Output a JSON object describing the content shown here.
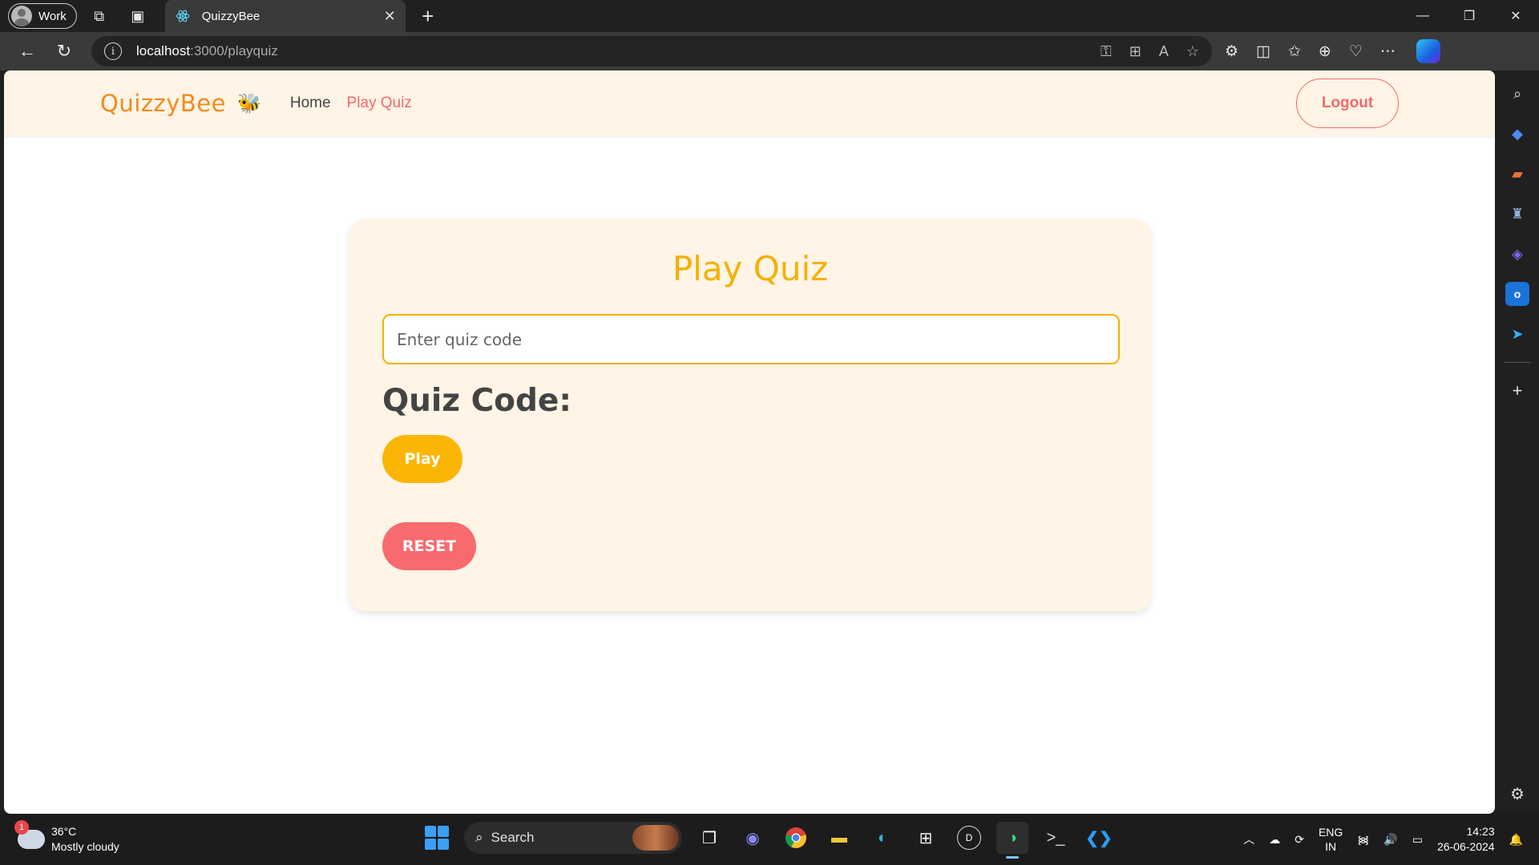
{
  "browser": {
    "profile_label": "Work",
    "tab_title": "QuizzyBee",
    "url_host": "localhost",
    "url_path": ":3000/playquiz"
  },
  "app": {
    "brand": "QuizzyBee",
    "nav": {
      "home": "Home",
      "play_quiz": "Play Quiz"
    },
    "logout_label": "Logout"
  },
  "card": {
    "title": "Play Quiz",
    "input_placeholder": "Enter quiz code",
    "code_label": "Quiz Code:",
    "play_label": "Play",
    "reset_label": "RESET"
  },
  "taskbar": {
    "weather_badge": "1",
    "temperature": "36°C",
    "condition": "Mostly cloudy",
    "search_label": "Search",
    "lang_line1": "ENG",
    "lang_line2": "IN",
    "time": "14:23",
    "date": "26-06-2024"
  },
  "colors": {
    "brand": "#f28a1d",
    "accent_yellow": "#f5b100",
    "accent_red": "#f2686c",
    "nav_bg": "#fff4e6"
  }
}
